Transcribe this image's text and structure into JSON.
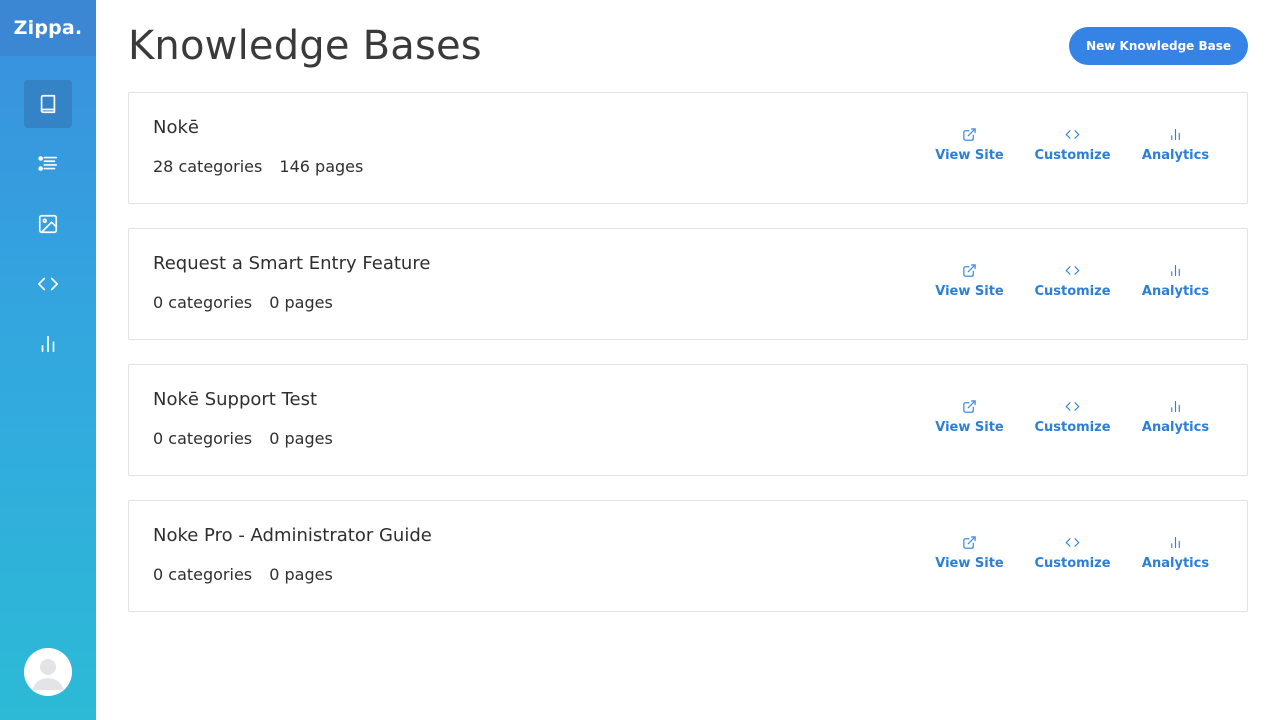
{
  "app": {
    "brand": "Zippa."
  },
  "sidebar": {
    "items": [
      {
        "name": "knowledge-bases",
        "icon": "book-icon",
        "active": true
      },
      {
        "name": "list",
        "icon": "list-icon",
        "active": false
      },
      {
        "name": "media",
        "icon": "image-icon",
        "active": false
      },
      {
        "name": "code",
        "icon": "code-icon",
        "active": false
      },
      {
        "name": "analytics",
        "icon": "bar-chart-icon",
        "active": false
      }
    ],
    "avatar_icon": "user-avatar-icon"
  },
  "header": {
    "title": "Knowledge Bases",
    "new_button_label": "New Knowledge Base"
  },
  "knowledge_bases": [
    {
      "name": "Nokē",
      "categories": "28 categories",
      "pages": "146 pages"
    },
    {
      "name": "Request a Smart Entry Feature",
      "categories": "0 categories",
      "pages": "0 pages"
    },
    {
      "name": "Nokē Support Test",
      "categories": "0 categories",
      "pages": "0 pages"
    },
    {
      "name": "Noke Pro - Administrator Guide",
      "categories": "0 categories",
      "pages": "0 pages"
    }
  ],
  "actions": {
    "view_site": "View Site",
    "customize": "Customize",
    "analytics": "Analytics"
  },
  "colors": {
    "accent": "#3583e4",
    "sidebar_top": "#3a8fde",
    "sidebar_bottom": "#2cbad6",
    "link": "#2c7ed6"
  }
}
